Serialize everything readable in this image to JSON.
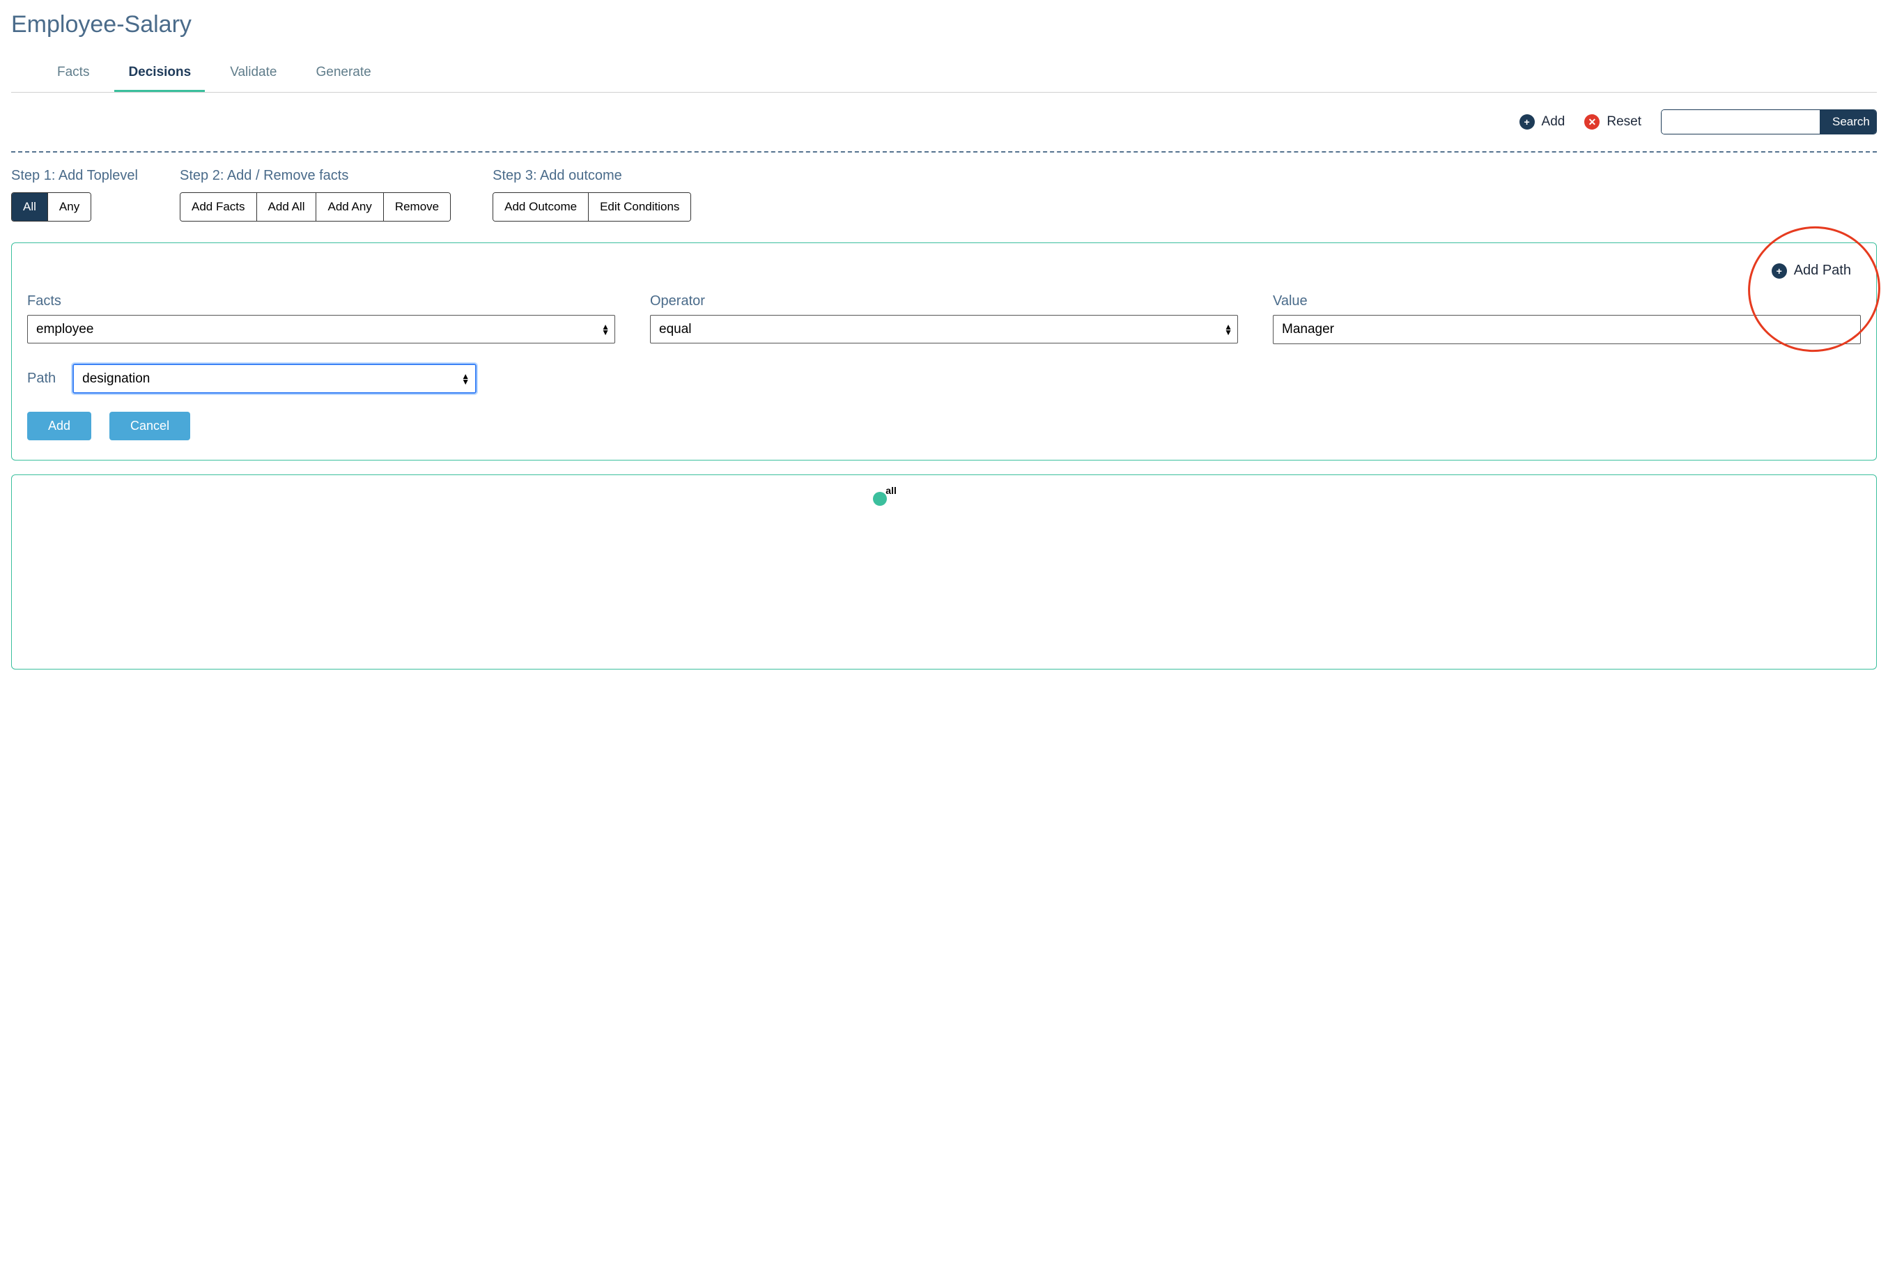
{
  "page": {
    "title": "Employee-Salary"
  },
  "tabs": {
    "facts": "Facts",
    "decisions": "Decisions",
    "validate": "Validate",
    "generate": "Generate",
    "active": "decisions"
  },
  "toolbar": {
    "add": "Add",
    "reset": "Reset",
    "search_btn": "Search",
    "search_value": ""
  },
  "steps": {
    "step1": {
      "label": "Step 1: Add Toplevel",
      "all": "All",
      "any": "Any",
      "active": "all"
    },
    "step2": {
      "label": "Step 2: Add / Remove facts",
      "add_facts": "Add Facts",
      "add_all": "Add All",
      "add_any": "Add Any",
      "remove": "Remove"
    },
    "step3": {
      "label": "Step 3: Add outcome",
      "add_outcome": "Add Outcome",
      "edit_conditions": "Edit Conditions"
    }
  },
  "editor": {
    "add_path": "Add Path",
    "facts_label": "Facts",
    "facts_value": "employee",
    "operator_label": "Operator",
    "operator_value": "equal",
    "value_label": "Value",
    "value_value": "Manager",
    "path_label": "Path",
    "path_value": "designation",
    "add_btn": "Add",
    "cancel_btn": "Cancel"
  },
  "graph": {
    "root_label": "all"
  }
}
